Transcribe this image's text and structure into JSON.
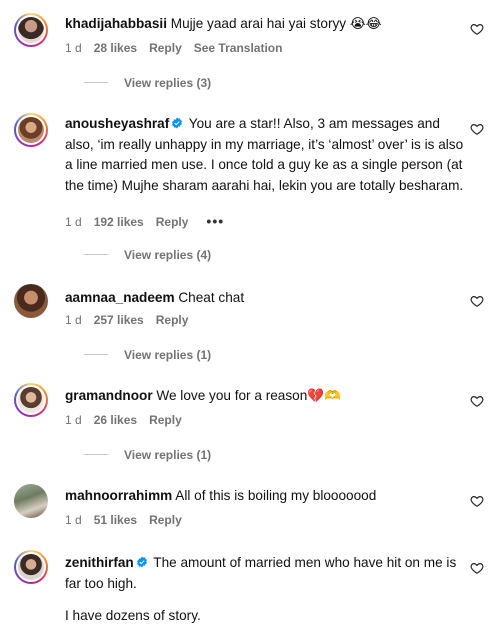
{
  "comments": [
    {
      "username": "khadijahabbasii",
      "verified": false,
      "text": "Mujje yaad arai hai yai storyy 😭😂",
      "time": "1 d",
      "likes": "28 likes",
      "reply_label": "Reply",
      "translate_label": "See Translation",
      "view_replies": "View replies (3)"
    },
    {
      "username": "anousheyashraf",
      "verified": true,
      "text": "You are a star!! Also, 3 am messages and also, ‘im really unhappy in my marriage, it’s ‘almost’ over’ is is also a line married men use. I once told a guy ke as a single person (at the time) Mujhe sharam aarahi hai, lekin you are totally besharam.",
      "time": "1 d",
      "likes": "192 likes",
      "reply_label": "Reply",
      "more": "•••",
      "view_replies": "View replies (4)"
    },
    {
      "username": "aamnaa_nadeem",
      "verified": false,
      "text": "Cheat chat",
      "time": "1 d",
      "likes": "257 likes",
      "reply_label": "Reply",
      "view_replies": "View replies (1)"
    },
    {
      "username": "gramandnoor",
      "verified": false,
      "text": "We love you for a reason💔🫶",
      "time": "1 d",
      "likes": "26 likes",
      "reply_label": "Reply",
      "view_replies": "View replies (1)"
    },
    {
      "username": "mahnoorrahimm",
      "verified": false,
      "text": "All of this is boiling my blooooood",
      "time": "1 d",
      "likes": "51 likes",
      "reply_label": "Reply"
    },
    {
      "username": "zenithirfan",
      "verified": true,
      "text": "The amount of married men who have hit on me is far too high.",
      "text2": "I have dozens of story."
    }
  ],
  "colors": {
    "secondary_text": "#737373",
    "verified_blue": "#0095f6"
  },
  "icons": {
    "like": "heart-outline-icon",
    "verified": "verified-badge-icon"
  }
}
